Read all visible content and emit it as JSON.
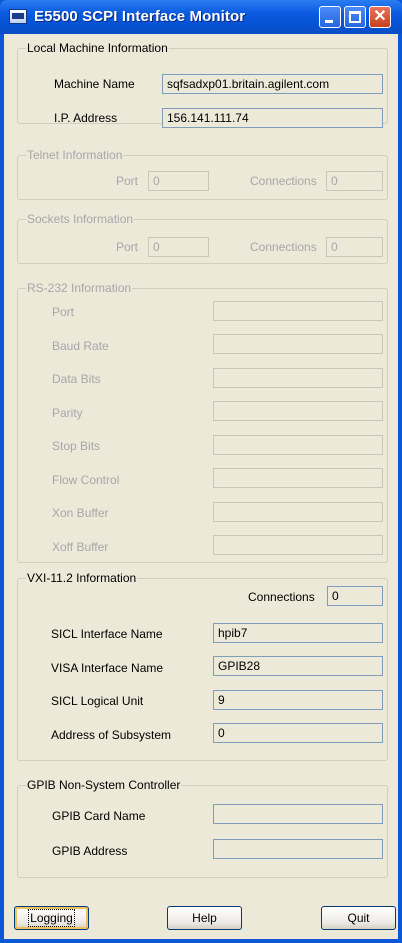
{
  "window": {
    "title": "E5500 SCPI Interface Monitor"
  },
  "local_machine": {
    "legend": "Local Machine Information",
    "machine_name_label": "Machine Name",
    "machine_name_value": "sqfsadxp01.britain.agilent.com",
    "ip_label": "I.P. Address",
    "ip_value": "156.141.111.74"
  },
  "telnet": {
    "legend": "Telnet Information",
    "port_label": "Port",
    "port_value": "0",
    "connections_label": "Connections",
    "connections_value": "0"
  },
  "sockets": {
    "legend": "Sockets Information",
    "port_label": "Port",
    "port_value": "0",
    "connections_label": "Connections",
    "connections_value": "0"
  },
  "rs232": {
    "legend": "RS-232 Information",
    "fields": [
      {
        "label": "Port",
        "value": ""
      },
      {
        "label": "Baud Rate",
        "value": ""
      },
      {
        "label": "Data Bits",
        "value": ""
      },
      {
        "label": "Parity",
        "value": ""
      },
      {
        "label": "Stop Bits",
        "value": ""
      },
      {
        "label": "Flow Control",
        "value": ""
      },
      {
        "label": "Xon Buffer",
        "value": ""
      },
      {
        "label": "Xoff Buffer",
        "value": ""
      }
    ]
  },
  "vxi": {
    "legend": "VXI-11.2 Information",
    "connections_label": "Connections",
    "connections_value": "0",
    "fields": [
      {
        "label": "SICL Interface Name",
        "value": "hpib7"
      },
      {
        "label": "VISA Interface Name",
        "value": "GPIB28"
      },
      {
        "label": "SICL Logical Unit",
        "value": "9"
      },
      {
        "label": "Address of Subsystem",
        "value": "0"
      }
    ]
  },
  "gpib": {
    "legend": "GPIB Non-System Controller",
    "card_name_label": "GPIB Card Name",
    "card_name_value": "",
    "address_label": "GPIB Address",
    "address_value": ""
  },
  "buttons": {
    "logging": "Logging",
    "help": "Help",
    "quit": "Quit"
  }
}
